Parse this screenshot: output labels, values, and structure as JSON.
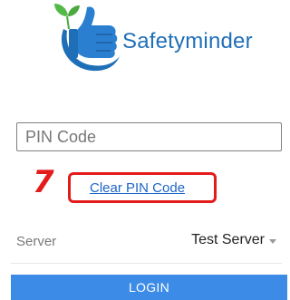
{
  "app": {
    "logo_text": "Safetyminder",
    "logo_icon": "thumbs-up-leaf-logo"
  },
  "pin": {
    "placeholder": "PIN Code",
    "value": ""
  },
  "annotation": {
    "step_number": "7"
  },
  "clear_pin": {
    "label": "Clear PIN Code"
  },
  "server": {
    "label": "Server",
    "selected": "Test Server"
  },
  "login": {
    "label": "LOGIN"
  },
  "colors": {
    "brand_blue": "#1f6fb8",
    "leaf_green": "#55b947",
    "link_blue": "#1d66c7",
    "annotation_red": "#e41b1b",
    "button_blue": "#3c8ce7"
  }
}
